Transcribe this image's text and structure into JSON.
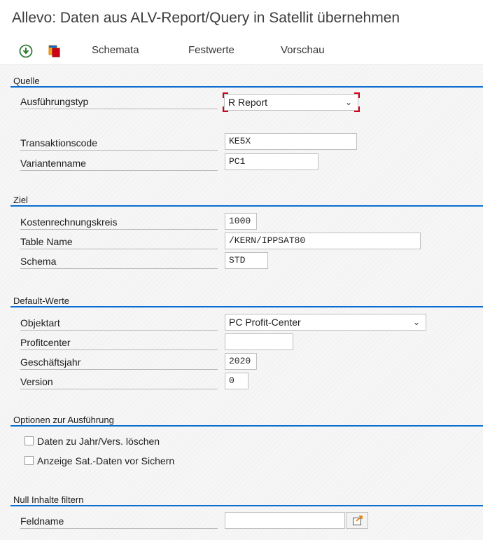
{
  "window": {
    "title": "Allevo: Daten aus ALV-Report/Query in Satellit übernehmen"
  },
  "toolbar": {
    "icons": [
      "execute-icon",
      "copy-documents-icon"
    ],
    "buttons": [
      "Schemata",
      "Festwerte",
      "Vorschau"
    ]
  },
  "quelle": {
    "title": "Quelle",
    "ausfuehrungstyp": {
      "label": "Ausführungstyp",
      "value": "R Report"
    },
    "transaktionscode": {
      "label": "Transaktionscode",
      "value": "KE5X"
    },
    "variantenname": {
      "label": "Variantenname",
      "value": "PC1"
    }
  },
  "ziel": {
    "title": "Ziel",
    "kostenrechnungskreis": {
      "label": "Kostenrechnungskreis",
      "value": "1000"
    },
    "table_name": {
      "label": "Table Name",
      "value": "/KERN/IPPSAT80"
    },
    "schema": {
      "label": "Schema",
      "value": "STD"
    }
  },
  "default_werte": {
    "title": "Default-Werte",
    "objektart": {
      "label": "Objektart",
      "value": "PC Profit-Center"
    },
    "profitcenter": {
      "label": "Profitcenter",
      "value": ""
    },
    "geschaeftsjahr": {
      "label": "Geschäftsjahr",
      "value": "2020"
    },
    "version": {
      "label": "Version",
      "value": "0"
    }
  },
  "optionen": {
    "title": "Optionen zur Ausführung",
    "daten_loeschen": {
      "label": "Daten zu Jahr/Vers. löschen",
      "checked": false
    },
    "anzeige_sat": {
      "label": "Anzeige Sat.-Daten vor Sichern",
      "checked": false
    }
  },
  "null_filter": {
    "title": "Null Inhalte filtern",
    "feldname": {
      "label": "Feldname",
      "value": ""
    }
  },
  "colors": {
    "accent": "#0a6ed1",
    "focus": "#d0021b",
    "icon_green": "#2e7d32",
    "icon_orange": "#e67e00"
  }
}
